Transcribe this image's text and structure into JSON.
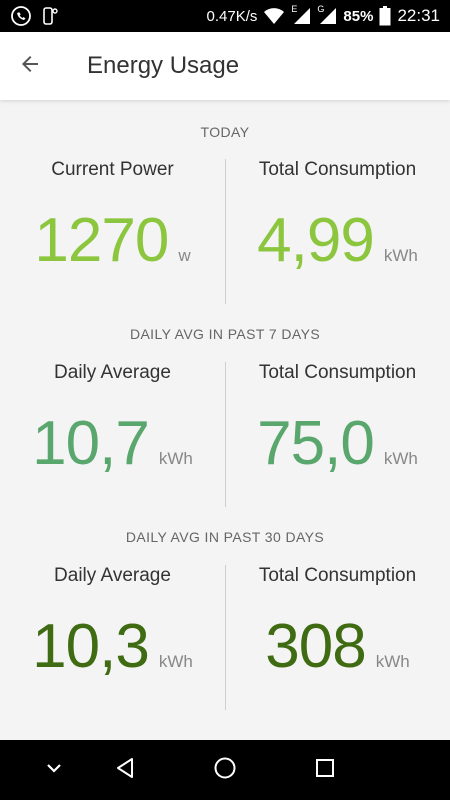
{
  "status_bar": {
    "network_speed": "0.47K/s",
    "battery": "85%",
    "time": "22:31",
    "signal1_label": "E",
    "signal2_label": "G",
    "icons": [
      "viber-icon",
      "notification-icon",
      "wifi-icon",
      "signal-icon",
      "signal-icon",
      "battery-icon"
    ]
  },
  "app_bar": {
    "title": "Energy Usage",
    "back_icon": "arrow-back-icon"
  },
  "sections": [
    {
      "label": "TODAY",
      "left": {
        "title": "Current Power",
        "value": "1270",
        "unit": "w"
      },
      "right": {
        "title": "Total Consumption",
        "value": "4,99",
        "unit": "kWh"
      },
      "color": "#8cc63f"
    },
    {
      "label": "DAILY AVG IN PAST 7 DAYS",
      "left": {
        "title": "Daily Average",
        "value": "10,7",
        "unit": "kWh"
      },
      "right": {
        "title": "Total Consumption",
        "value": "75,0",
        "unit": "kWh"
      },
      "color": "#5aa76e"
    },
    {
      "label": "DAILY AVG IN PAST 30 DAYS",
      "left": {
        "title": "Daily Average",
        "value": "10,3",
        "unit": "kWh"
      },
      "right": {
        "title": "Total Consumption",
        "value": "308",
        "unit": "kWh"
      },
      "color": "#3f6b12"
    }
  ],
  "nav_bar": {
    "icons": [
      "chevron-down-icon",
      "back-triangle-icon",
      "home-circle-icon",
      "recents-square-icon"
    ]
  }
}
